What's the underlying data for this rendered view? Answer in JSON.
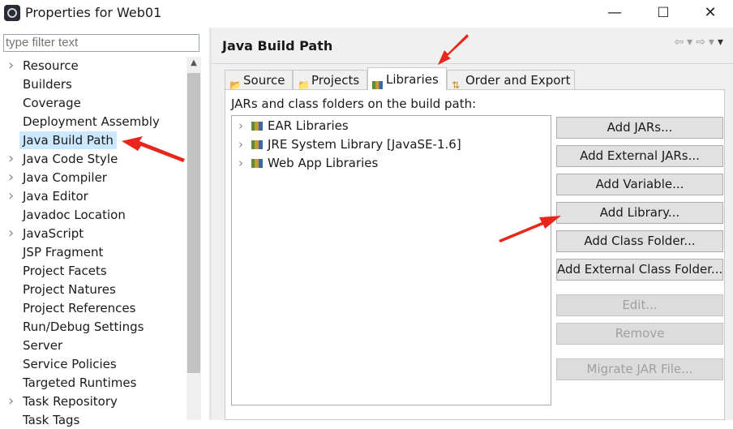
{
  "window": {
    "title": "Properties for Web01",
    "minimize": "—",
    "maximize": "☐",
    "close": "✕"
  },
  "filter": {
    "placeholder": "type filter text"
  },
  "nav_items": [
    {
      "label": "Resource",
      "expandable": true
    },
    {
      "label": "Builders",
      "expandable": false
    },
    {
      "label": "Coverage",
      "expandable": false
    },
    {
      "label": "Deployment Assembly",
      "expandable": false
    },
    {
      "label": "Java Build Path",
      "expandable": false,
      "selected": true
    },
    {
      "label": "Java Code Style",
      "expandable": true
    },
    {
      "label": "Java Compiler",
      "expandable": true
    },
    {
      "label": "Java Editor",
      "expandable": true
    },
    {
      "label": "Javadoc Location",
      "expandable": false
    },
    {
      "label": "JavaScript",
      "expandable": true
    },
    {
      "label": "JSP Fragment",
      "expandable": false
    },
    {
      "label": "Project Facets",
      "expandable": false
    },
    {
      "label": "Project Natures",
      "expandable": false
    },
    {
      "label": "Project References",
      "expandable": false
    },
    {
      "label": "Run/Debug Settings",
      "expandable": false
    },
    {
      "label": "Server",
      "expandable": false
    },
    {
      "label": "Service Policies",
      "expandable": false
    },
    {
      "label": "Targeted Runtimes",
      "expandable": false
    },
    {
      "label": "Task Repository",
      "expandable": true
    },
    {
      "label": "Task Tags",
      "expandable": false
    }
  ],
  "page": {
    "title": "Java Build Path"
  },
  "tabs": [
    {
      "label": "Source",
      "icon": "source-folder-icon"
    },
    {
      "label": "Projects",
      "icon": "projects-icon"
    },
    {
      "label": "Libraries",
      "icon": "libraries-icon",
      "active": true
    },
    {
      "label": "Order and Export",
      "icon": "order-export-icon"
    }
  ],
  "libraries": {
    "caption": "JARs and class folders on the build path:",
    "items": [
      "EAR Libraries",
      "JRE System Library [JavaSE-1.6]",
      "Web App Libraries"
    ]
  },
  "buttons": [
    {
      "label": "Add JARs...",
      "enabled": true
    },
    {
      "label": "Add External JARs...",
      "enabled": true
    },
    {
      "label": "Add Variable...",
      "enabled": true
    },
    {
      "label": "Add Library...",
      "enabled": true
    },
    {
      "label": "Add Class Folder...",
      "enabled": true
    },
    {
      "label": "Add External Class Folder...",
      "enabled": true
    },
    {
      "label": "Edit...",
      "enabled": false
    },
    {
      "label": "Remove",
      "enabled": false
    },
    {
      "label": "Migrate JAR File...",
      "enabled": false
    }
  ],
  "colors": {
    "selection": "#cce8ff",
    "annotation_arrow": "#e8261c",
    "panel_bg": "#f0f0f0"
  }
}
